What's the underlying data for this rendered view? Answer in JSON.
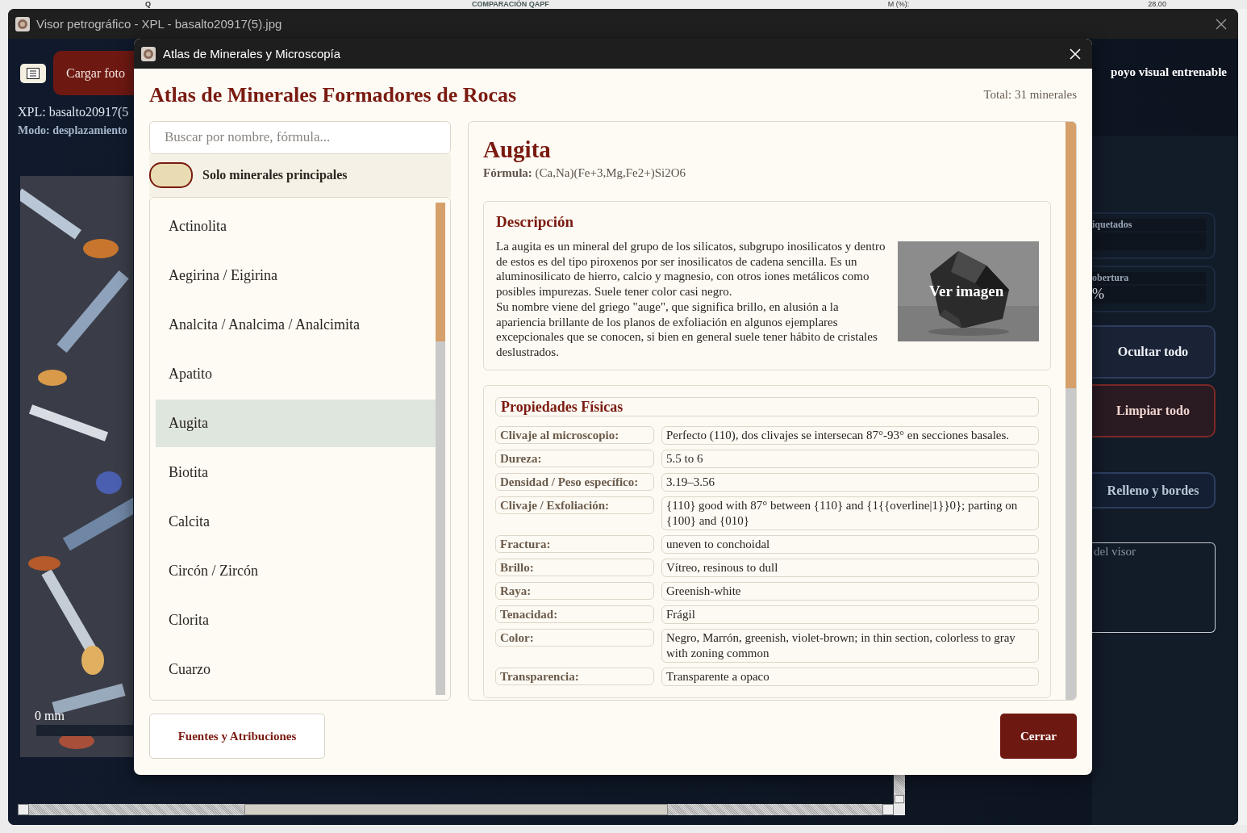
{
  "background": {
    "texts": [
      "Q",
      "COMPARACIÓN QAPF",
      "M (%):",
      "28.00"
    ]
  },
  "window": {
    "title": "Visor petrográfico - XPL - basalto20917(5).jpg"
  },
  "viewer": {
    "load_button": "Cargar foto",
    "file_label": "XPL: basalto20917(5",
    "mode_label": "Modo: desplazamiento",
    "scale_label": "0 mm"
  },
  "side_panel": {
    "heading": "poyo visual entrenable",
    "fields": [
      {
        "label": "iquetados"
      },
      {
        "label": "obertura",
        "value": "%"
      }
    ],
    "buttons": [
      {
        "label": "Ocultar todo",
        "kind": "normal"
      },
      {
        "label": "Limpiar todo",
        "kind": "danger"
      },
      {
        "label": "Relleno y bordes",
        "kind": "outline"
      }
    ],
    "notes": {
      "placeholder": "del visor"
    }
  },
  "dialog": {
    "title": "Atlas de Minerales y Microscopía",
    "heading": "Atlas de Minerales Formadores de Rocas",
    "total": "Total: 31 minerales",
    "search": {
      "placeholder": "Buscar por nombre, fórmula..."
    },
    "filter": {
      "label": "Solo minerales principales",
      "on": false
    },
    "minerals": [
      {
        "name": "Actinolita",
        "selected": false
      },
      {
        "name": "Aegirina / Eigirina",
        "selected": false
      },
      {
        "name": "Analcita / Analcima / Analcimita",
        "selected": false
      },
      {
        "name": "Apatito",
        "selected": false
      },
      {
        "name": "Augita",
        "selected": true
      },
      {
        "name": "Biotita",
        "selected": false
      },
      {
        "name": "Calcita",
        "selected": false
      },
      {
        "name": "Circón / Zircón",
        "selected": false
      },
      {
        "name": "Clorita",
        "selected": false
      },
      {
        "name": "Cuarzo",
        "selected": false
      }
    ],
    "detail": {
      "name": "Augita",
      "formula_label": "Fórmula:",
      "formula": "(Ca,Na)(Fe+3,Mg,Fe2+)Si2O6",
      "description": {
        "title": "Descripción",
        "paragraphs": [
          "La augita es un mineral del grupo de los silicatos, subgrupo inosilicatos y dentro de estos es del tipo piroxenos por ser inosilicatos de cadena sencilla. Es un aluminosilicato de hierro, calcio y magnesio, con otros iones metálicos como posibles impurezas. Suele tener color casi negro.",
          "Su nombre viene del griego \"auge\", que significa brillo, en alusión a la apariencia brillante de los planos de exfoliación en algunos ejemplares excepcionales que se conocen, si bien en general suele tener hábito de cristales deslustrados."
        ],
        "image_label": "Ver imagen"
      },
      "properties": {
        "title": "Propiedades Físicas",
        "rows": [
          {
            "label": "Clivaje al microscopio:",
            "value": "Perfecto (110), dos clivajes se intersecan 87°-93° en secciones basales."
          },
          {
            "label": "Dureza:",
            "value": "5.5 to 6"
          },
          {
            "label": "Densidad / Peso específico:",
            "value": "3.19–3.56"
          },
          {
            "label": "Clivaje / Exfoliación:",
            "value": "{110} good with 87° between {110} and {1{{overline|1}}0}; parting on {100} and {010}"
          },
          {
            "label": "Fractura:",
            "value": "uneven to conchoidal"
          },
          {
            "label": "Brillo:",
            "value": "Vítreo, resinous to dull"
          },
          {
            "label": "Raya:",
            "value": "Greenish-white"
          },
          {
            "label": "Tenacidad:",
            "value": "Frágil"
          },
          {
            "label": "Color:",
            "value": "Negro, Marrón, greenish, violet-brown; in thin section, colorless to gray with zoning common"
          },
          {
            "label": "Transparencia:",
            "value": "Transparente a opaco"
          }
        ]
      }
    },
    "buttons": [
      {
        "label": "Fuentes y Atribuciones",
        "kind": "secondary"
      },
      {
        "label": "Cerrar",
        "kind": "primary"
      }
    ]
  }
}
